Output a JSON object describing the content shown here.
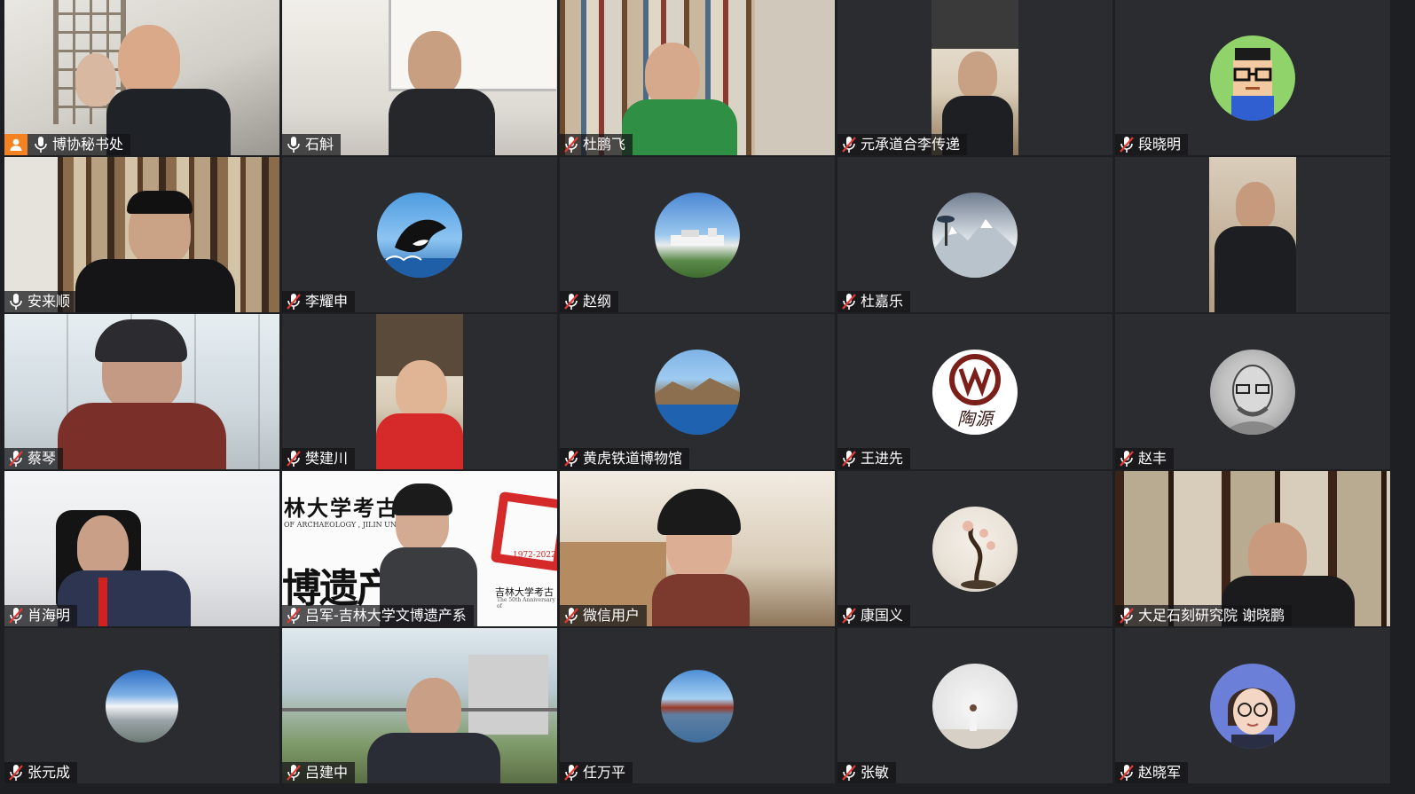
{
  "participants": [
    {
      "name": "博协秘书处",
      "mic": "on",
      "host": true
    },
    {
      "name": "石斛",
      "mic": "on"
    },
    {
      "name": "杜鹏飞",
      "mic": "muted"
    },
    {
      "name": "元承道合李传递",
      "mic": "muted"
    },
    {
      "name": "段晓明",
      "mic": "muted"
    },
    {
      "name": "安来顺",
      "mic": "on"
    },
    {
      "name": "李耀申",
      "mic": "muted"
    },
    {
      "name": "赵纲",
      "mic": "muted"
    },
    {
      "name": "杜嘉乐",
      "mic": "muted"
    },
    {
      "name": "",
      "mic": "none"
    },
    {
      "name": "蔡琴",
      "mic": "muted"
    },
    {
      "name": "樊建川",
      "mic": "muted"
    },
    {
      "name": "黄虎铁道博物馆",
      "mic": "muted"
    },
    {
      "name": "王进先",
      "mic": "muted"
    },
    {
      "name": "赵丰",
      "mic": "muted"
    },
    {
      "name": "肖海明",
      "mic": "muted"
    },
    {
      "name": "吕军-吉林大学文博遗产系",
      "mic": "muted"
    },
    {
      "name": "微信用户",
      "mic": "muted"
    },
    {
      "name": "康国义",
      "mic": "muted"
    },
    {
      "name": "大足石刻研究院 谢晓鹏",
      "mic": "muted"
    },
    {
      "name": "张元成",
      "mic": "muted"
    },
    {
      "name": "吕建中",
      "mic": "muted"
    },
    {
      "name": "任万平",
      "mic": "muted"
    },
    {
      "name": "张敏",
      "mic": "muted"
    },
    {
      "name": "赵晓军",
      "mic": "muted"
    }
  ],
  "banner": {
    "top_text": "林大学考古",
    "sub_text": "OF ARCHAEOLOGY , JILIN UNIVE",
    "big_text": "博遗产系",
    "years": "1972-2022",
    "small": "吉林大学考古",
    "small2": "The 50th Anniversary of"
  },
  "seal_text": "陶源",
  "colors": {
    "background": "#1e1f22",
    "tile": "#2b2c30",
    "active_border": "#2fb34a",
    "host_badge": "#f58220",
    "muted_mic": "#e53935"
  }
}
